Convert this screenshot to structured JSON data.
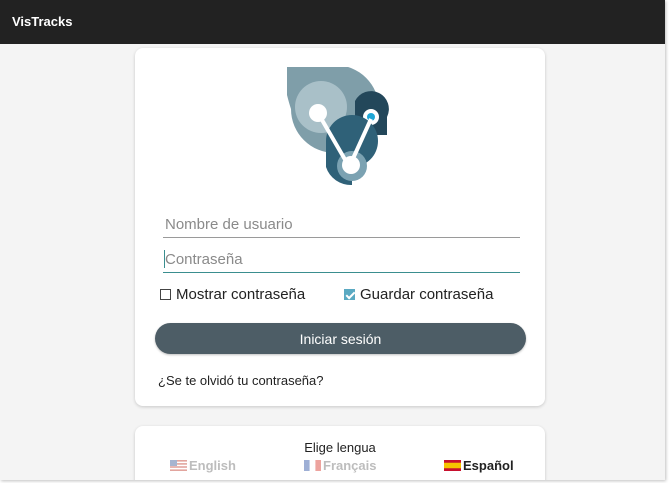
{
  "app": {
    "title": "VisTracks"
  },
  "login": {
    "username_placeholder": "Nombre de usuario",
    "password_placeholder": "Contraseña",
    "show_password_label": "Mostrar contraseña",
    "show_password_checked": false,
    "save_password_label": "Guardar contraseña",
    "save_password_checked": true,
    "submit_label": "Iniciar sesión",
    "forgot_label": "¿Se te olvidó tu contraseña?"
  },
  "language": {
    "title": "Elige lengua",
    "options": [
      {
        "label": "English",
        "selected": false,
        "flag": "us-flag-icon"
      },
      {
        "label": "Français",
        "selected": false,
        "flag": "fr-flag-icon"
      },
      {
        "label": "Español",
        "selected": true,
        "flag": "es-flag-icon"
      }
    ]
  },
  "colors": {
    "appbar": "#222222",
    "button": "#4d5d66",
    "accent": "#3a8e8f",
    "checkbox": "#5aa9c2"
  }
}
